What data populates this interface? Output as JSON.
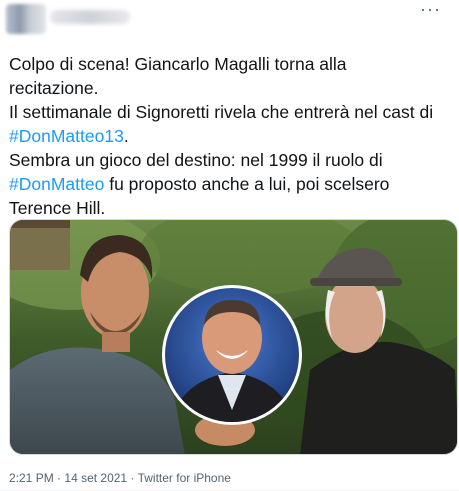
{
  "header": {
    "more_label": "···"
  },
  "tweet": {
    "lines": [
      [
        {
          "text": "Colpo di scena! Giancarlo Magalli torna alla",
          "tag": false
        }
      ],
      [
        {
          "text": "recitazione.",
          "tag": false
        }
      ],
      [
        {
          "text": "Il settimanale di Signoretti rivela che entrerà nel cast di",
          "tag": false
        }
      ],
      [
        {
          "text": "#DonMatteo13",
          "tag": true
        },
        {
          "text": ".",
          "tag": false
        }
      ],
      [
        {
          "text": "Sembra un gioco del destino: nel 1999 il ruolo di",
          "tag": false
        }
      ],
      [
        {
          "text": "#DonMatteo",
          "tag": true
        },
        {
          "text": " fu proposto anche a lui, poi scelsero",
          "tag": false
        }
      ],
      [
        {
          "text": "Terence Hill.",
          "tag": false
        }
      ]
    ],
    "hashtag_color": "#1d9bf0",
    "text_color": "#0f1419"
  },
  "meta": {
    "time": "2:21 PM",
    "date": "14 set 2021",
    "source": "Twitter for iPhone",
    "separator": "·",
    "color": "#536471"
  }
}
